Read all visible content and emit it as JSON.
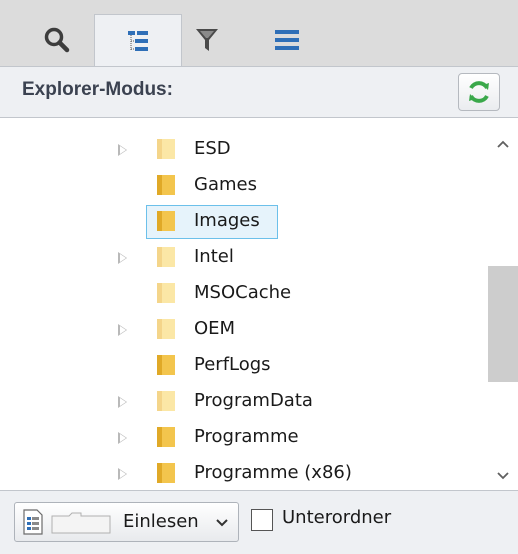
{
  "toolbar": {
    "tabs": [
      {
        "icon": "search-icon",
        "active": false
      },
      {
        "icon": "tree-view-icon",
        "active": true
      },
      {
        "icon": "filter-icon",
        "active": false
      },
      {
        "icon": "list-menu-icon",
        "active": false
      }
    ]
  },
  "mode": {
    "label": "Explorer-Modus:",
    "refresh_icon": "refresh-icon"
  },
  "tree": {
    "items": [
      {
        "name": "ESD",
        "expandable": true,
        "selected": false
      },
      {
        "name": "Games",
        "expandable": false,
        "selected": false
      },
      {
        "name": "Images",
        "expandable": false,
        "selected": true
      },
      {
        "name": "Intel",
        "expandable": true,
        "selected": false
      },
      {
        "name": "MSOCache",
        "expandable": false,
        "selected": false
      },
      {
        "name": "OEM",
        "expandable": true,
        "selected": false
      },
      {
        "name": "PerfLogs",
        "expandable": false,
        "selected": false
      },
      {
        "name": "ProgramData",
        "expandable": true,
        "selected": false
      },
      {
        "name": "Programme",
        "expandable": true,
        "selected": false
      },
      {
        "name": "Programme (x86)",
        "expandable": true,
        "selected": false
      }
    ]
  },
  "bottom": {
    "read_button_label": "Einlesen",
    "subfolder_label": "Unterordner",
    "subfolder_checked": false
  },
  "colors": {
    "toolbar_bg": "#dcdcdc",
    "panel_bg": "#eef0f3",
    "accent_blue": "#2f6fb7",
    "refresh_green": "#3aa84a",
    "selection_border": "#6cc0ea",
    "selection_fill": "#e6f3fb",
    "folder_yellow": "#f3c54d"
  }
}
